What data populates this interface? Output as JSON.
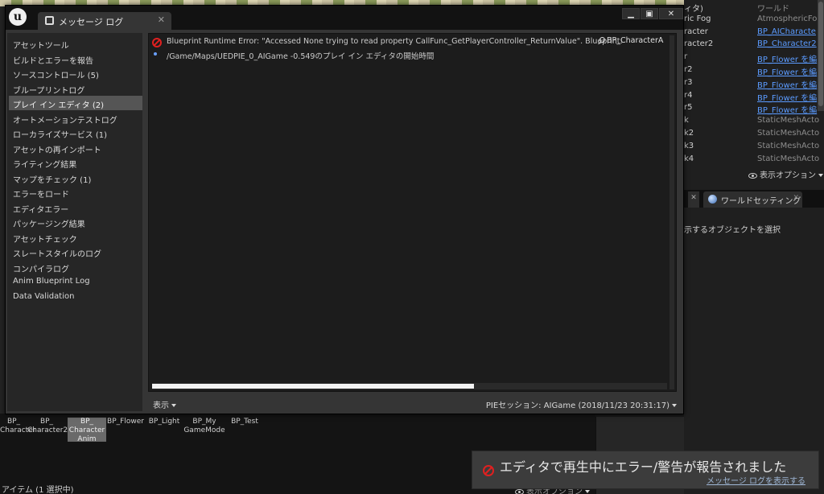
{
  "window": {
    "tab_title": "メッセージ ログ",
    "logo_glyph": "u",
    "minimize_glyph": "▁",
    "maximize_glyph": "▣",
    "close_glyph": "✕",
    "tab_close_glyph": "✕"
  },
  "sidebar": {
    "items": [
      {
        "label": "アセットツール"
      },
      {
        "label": "ビルドとエラーを報告"
      },
      {
        "label": "ソースコントロール (5)"
      },
      {
        "label": "ブループリントログ"
      },
      {
        "label": "プレイ イン エディタ (2)"
      },
      {
        "label": "オートメーションテストログ"
      },
      {
        "label": "ローカライズサービス (1)"
      },
      {
        "label": "アセットの再インポート"
      },
      {
        "label": "ライティング結果"
      },
      {
        "label": "マップをチェック (1)"
      },
      {
        "label": "エラーをロード"
      },
      {
        "label": "エディタエラー"
      },
      {
        "label": "パッケージング結果"
      },
      {
        "label": "アセットチェック"
      },
      {
        "label": "スレートスタイルのログ"
      },
      {
        "label": "コンパイラログ"
      },
      {
        "label": "Anim Blueprint Log"
      },
      {
        "label": "Data Validation"
      }
    ],
    "selected_index": 4
  },
  "log": {
    "messages": [
      {
        "severity": "error",
        "text": "Blueprint Runtime Error: \"Accessed None trying to read property CallFunc_GetPlayerController_ReturnValue\".  Blueprint:",
        "link": "BP_CharacterAnim"
      },
      {
        "severity": "info",
        "text": "/Game/Maps/UEDPIE_0_AIGame -0.549のプレイ イン エディタの開始時間"
      }
    ],
    "display_label": "表示",
    "session_label": "PIEセッション: AIGame (2018/11/23 20:31:17)"
  },
  "outliner": {
    "rows": [
      {
        "name": "ィタ)",
        "type": "ワールド",
        "link": false
      },
      {
        "name": "ric Fog",
        "type": "AtmosphericFog",
        "link": false
      },
      {
        "name": "racter",
        "type": "BP_AICharacte",
        "link": true
      },
      {
        "name": "racter2",
        "type": "BP_Character2",
        "link": true
      },
      {
        "name": "r",
        "type": "BP_Flower を編",
        "link": true
      },
      {
        "name": "r2",
        "type": "BP_Flower を編",
        "link": true
      },
      {
        "name": "r3",
        "type": "BP_Flower を編",
        "link": true
      },
      {
        "name": "r4",
        "type": "BP_Flower を編",
        "link": true
      },
      {
        "name": "r5",
        "type": "BP_Flower を編",
        "link": true
      },
      {
        "name": "k",
        "type": "StaticMeshActo",
        "link": false
      },
      {
        "name": "k2",
        "type": "StaticMeshActo",
        "link": false
      },
      {
        "name": "k3",
        "type": "StaticMeshActo",
        "link": false
      },
      {
        "name": "k4",
        "type": "StaticMeshActo",
        "link": false
      }
    ],
    "view_options_label": "表示オプション"
  },
  "details": {
    "tab_label": "ワールドセッティング",
    "tab_close_glyph": "✕",
    "small_tab_glyph": "✕",
    "hint": "示するオブジェクトを選択"
  },
  "content_browser": {
    "assets": [
      {
        "label": "BP_\nCharacter"
      },
      {
        "label": "BP_\nCharacter2"
      },
      {
        "label": "BP_\nCharacter\nAnim"
      },
      {
        "label": "BP_Flower"
      },
      {
        "label": "BP_Light"
      },
      {
        "label": "BP_My\nGameMode"
      },
      {
        "label": "BP_Test"
      }
    ],
    "selected_asset": 2,
    "status": "アイテム (1 選択中)",
    "view_options_label": "表示オプション"
  },
  "toast": {
    "message": "エディタで再生中にエラー/警告が報告されました",
    "link": "メッセージ ログを表示する"
  },
  "colors": {
    "accent_link": "#5b9bff",
    "error_red": "#e02020",
    "selected_bg": "#555555"
  }
}
